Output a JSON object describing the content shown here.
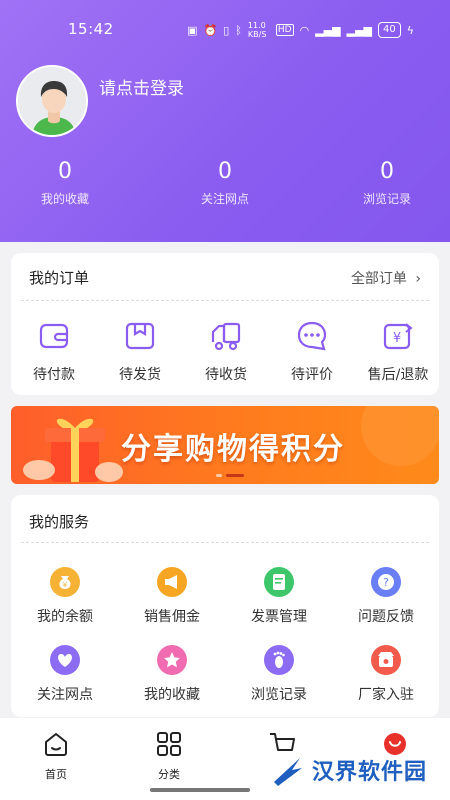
{
  "status_bar": {
    "time": "15:42",
    "network_speed": "11.0 KB/S",
    "battery": "40"
  },
  "profile": {
    "login_prompt": "请点击登录"
  },
  "stats": [
    {
      "value": "0",
      "label": "我的收藏"
    },
    {
      "value": "0",
      "label": "关注网点"
    },
    {
      "value": "0",
      "label": "浏览记录"
    }
  ],
  "orders": {
    "title": "我的订单",
    "all_link": "全部订单",
    "items": [
      {
        "label": "待付款",
        "icon": "wallet-icon"
      },
      {
        "label": "待发货",
        "icon": "package-icon"
      },
      {
        "label": "待收货",
        "icon": "truck-icon"
      },
      {
        "label": "待评价",
        "icon": "comment-icon"
      },
      {
        "label": "售后/退款",
        "icon": "refund-icon"
      }
    ],
    "icon_color": "#8a5cf0"
  },
  "banner": {
    "text": "分享购物得积分"
  },
  "services": {
    "title": "我的服务",
    "items": [
      {
        "label": "我的余额",
        "icon": "money-bag-icon",
        "color": "#f5b234"
      },
      {
        "label": "销售佣金",
        "icon": "megaphone-icon",
        "color": "#f6a623"
      },
      {
        "label": "发票管理",
        "icon": "invoice-icon",
        "color": "#3ec66b"
      },
      {
        "label": "问题反馈",
        "icon": "question-icon",
        "color": "#6a7ff5"
      },
      {
        "label": "关注网点",
        "icon": "heart-icon",
        "color": "#8b6cf2"
      },
      {
        "label": "我的收藏",
        "icon": "star-icon",
        "color": "#f06bb0"
      },
      {
        "label": "浏览记录",
        "icon": "footprint-icon",
        "color": "#8b6cf2"
      },
      {
        "label": "厂家入驻",
        "icon": "store-icon",
        "color": "#f25a4c"
      }
    ]
  },
  "tabbar": {
    "items": [
      {
        "label": "首页",
        "icon": "home-icon"
      },
      {
        "label": "分类",
        "icon": "grid-icon"
      },
      {
        "label": "",
        "icon": "cart-icon"
      },
      {
        "label": "",
        "icon": "profile-icon"
      }
    ]
  },
  "watermark": {
    "text": "汉界软件园"
  },
  "colors": {
    "header": "#8a5cf0",
    "accent": "#8a5cf0",
    "banner": "#ff6a22"
  }
}
